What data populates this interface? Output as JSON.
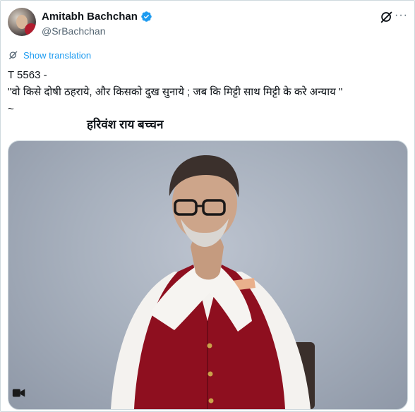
{
  "author": {
    "display_name": "Amitabh Bachchan",
    "handle": "@SrBachchan",
    "verified": true
  },
  "actions": {
    "grok_icon": "grok-icon",
    "more_icon": "more-icon"
  },
  "translate": {
    "label": "Show translation"
  },
  "tweet": {
    "line1": "T 5563 -",
    "line2": "\"वो किसे दोषी ठहराये, और किसको दुख सुनाये  ; जब कि मिट्टी साथ मिट्टी के करे अन्याय \"",
    "line3": "~",
    "attribution": "हरिवंश राय बच्चन"
  },
  "media": {
    "type": "photo",
    "icon": "media-icon"
  },
  "colors": {
    "link": "#1d9bf0",
    "verified": "#1d9bf0",
    "secondary_text": "#536471",
    "border": "#cfd9de"
  }
}
